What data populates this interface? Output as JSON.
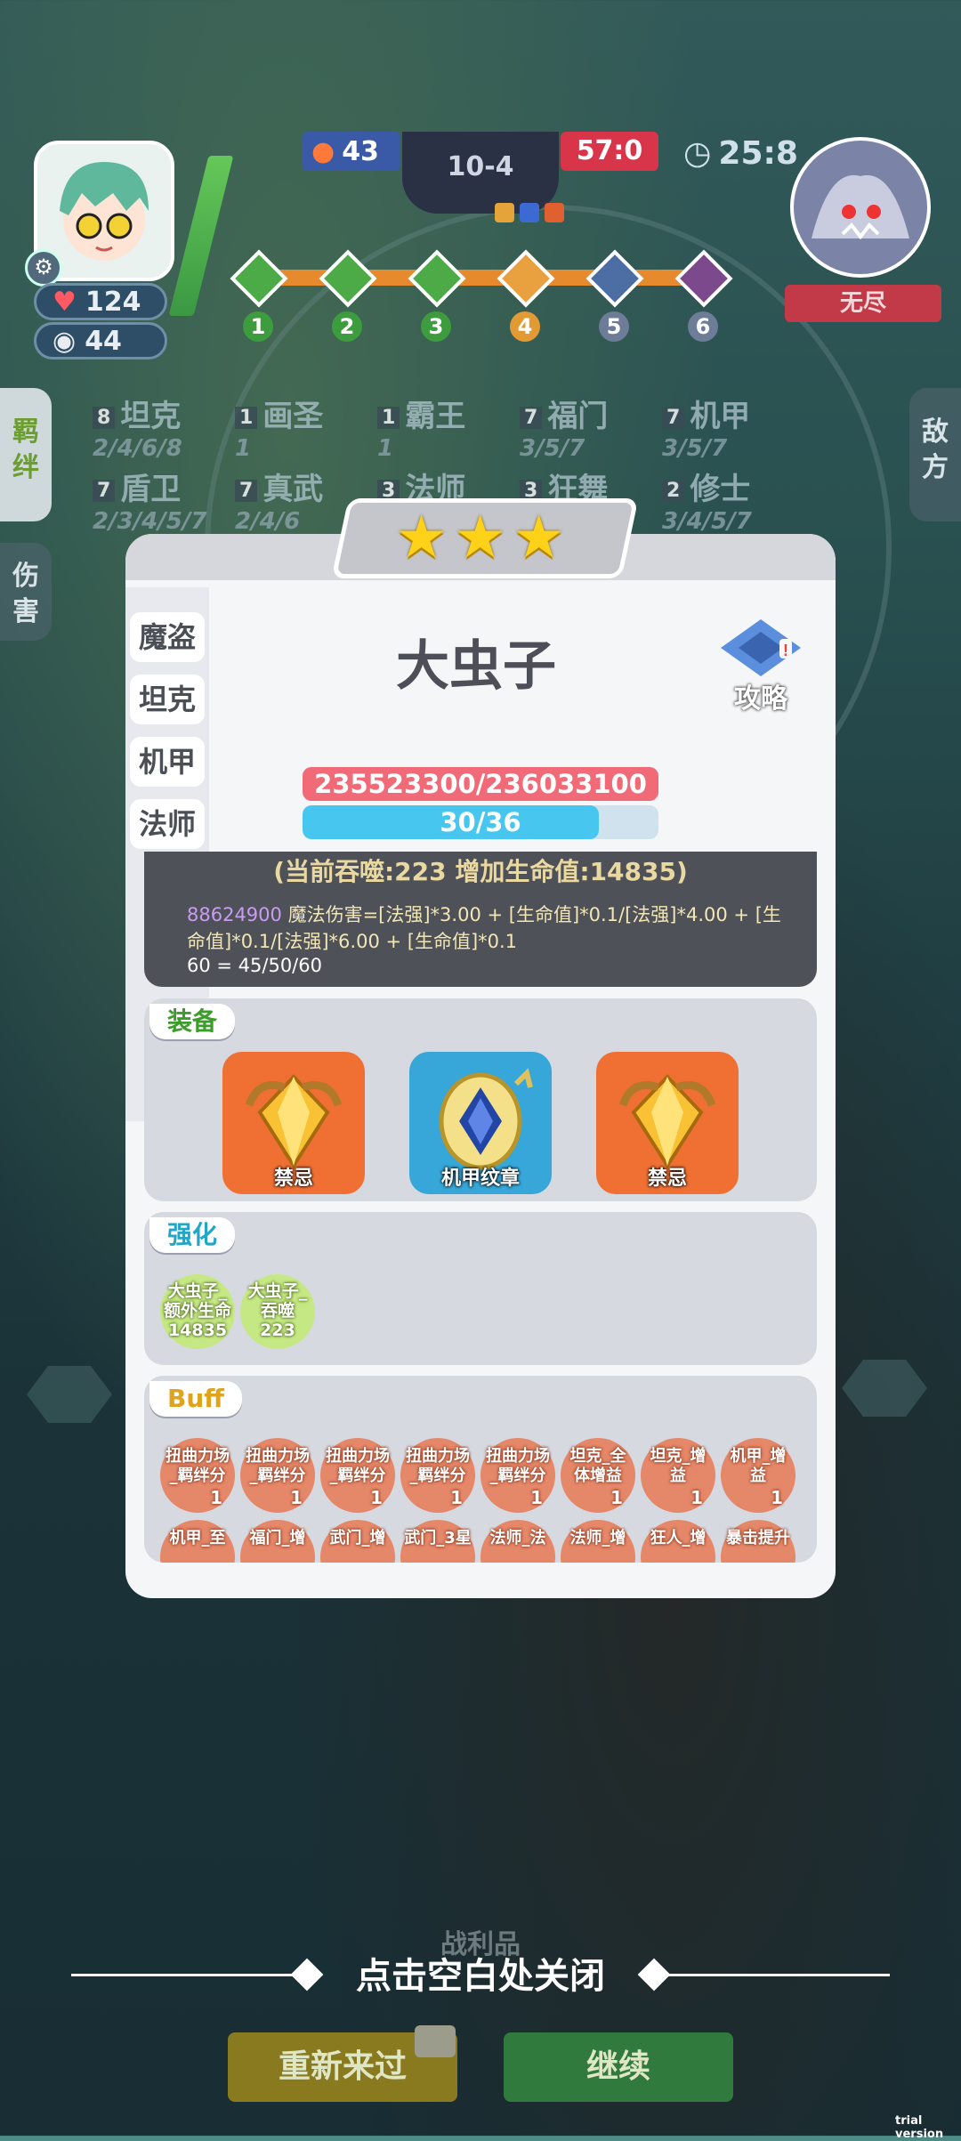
{
  "hud": {
    "left_hp": "124",
    "left_gold": "44",
    "fire_count": "43",
    "stage": "10-4",
    "score": "57:0",
    "timer": "25:8",
    "enemy_name": "无尽",
    "stage_nodes": [
      "1",
      "2",
      "3",
      "4",
      "5",
      "6"
    ]
  },
  "side_tabs": {
    "synergy": "羁绊",
    "damage": "伤害",
    "enemy": "敌方"
  },
  "synergies": [
    {
      "count": "8",
      "name": "坦克",
      "steps": "2/4/6/8"
    },
    {
      "count": "1",
      "name": "画圣",
      "steps": "1"
    },
    {
      "count": "1",
      "name": "霸王",
      "steps": "1"
    },
    {
      "count": "7",
      "name": "福门",
      "steps": "3/5/7"
    },
    {
      "count": "7",
      "name": "机甲",
      "steps": "3/5/7"
    },
    {
      "count": "7",
      "name": "盾卫",
      "steps": "2/3/4/5/7"
    },
    {
      "count": "7",
      "name": "真武",
      "steps": "2/4/6"
    },
    {
      "count": "3",
      "name": "法师",
      "steps": ""
    },
    {
      "count": "3",
      "name": "狂舞",
      "steps": ""
    },
    {
      "count": "2",
      "name": "修士",
      "steps": "3/4/5/7"
    }
  ],
  "panel": {
    "star_count": 3,
    "categories": [
      "魔盗",
      "坦克",
      "机甲",
      "法师"
    ],
    "hero_name": "大虫子",
    "guide_label": "攻略",
    "hp_text": "235523300/236033100",
    "mp_text": "30/36",
    "mp_ratio": 0.833,
    "devour_line": "(当前吞噬:223 增加生命值:14835)",
    "skill_value": "88624900",
    "skill_formula": " 魔法伤害=[法强]*3.00 + [生命值]*0.1/[法强]*4.00 + [生命值]*0.1/[法强]*6.00 + [生命值]*0.1",
    "skill_line3": "60 = 45/50/60",
    "equip_label": "装备",
    "equipment": [
      {
        "name": "禁忌",
        "color": "#f07034"
      },
      {
        "name": "机甲纹章",
        "color": "#37a6d8"
      },
      {
        "name": "禁忌",
        "color": "#f07034"
      }
    ],
    "enhance_label": "强化",
    "enhancements": [
      {
        "line1": "大虫子_",
        "line2": "额外生命",
        "line3": "14835"
      },
      {
        "line1": "大虫子_",
        "line2": "吞噬",
        "line3": "223"
      }
    ],
    "buff_label": "Buff",
    "buffs_row1": [
      {
        "line1": "扭曲力场",
        "line2": "_羁绊分",
        "v": "1"
      },
      {
        "line1": "扭曲力场",
        "line2": "_羁绊分",
        "v": "1"
      },
      {
        "line1": "扭曲力场",
        "line2": "_羁绊分",
        "v": "1"
      },
      {
        "line1": "扭曲力场",
        "line2": "_羁绊分",
        "v": "1"
      },
      {
        "line1": "扭曲力场",
        "line2": "_羁绊分",
        "v": "1"
      },
      {
        "line1": "坦克_全",
        "line2": "体增益",
        "v": "1"
      },
      {
        "line1": "坦克_增",
        "line2": "益",
        "v": "1"
      },
      {
        "line1": "机甲_增",
        "line2": "益",
        "v": "1"
      }
    ],
    "buffs_row2": [
      "机甲_至",
      "福门_增",
      "武门_增",
      "武门_3星",
      "法师_法",
      "法师_增",
      "狂人_增",
      "暴击提升"
    ]
  },
  "close_hint": "点击空白处关闭",
  "bottom": {
    "loot": "战利品",
    "retry": "重新来过",
    "continue": "继续"
  },
  "watermark": "trial version"
}
